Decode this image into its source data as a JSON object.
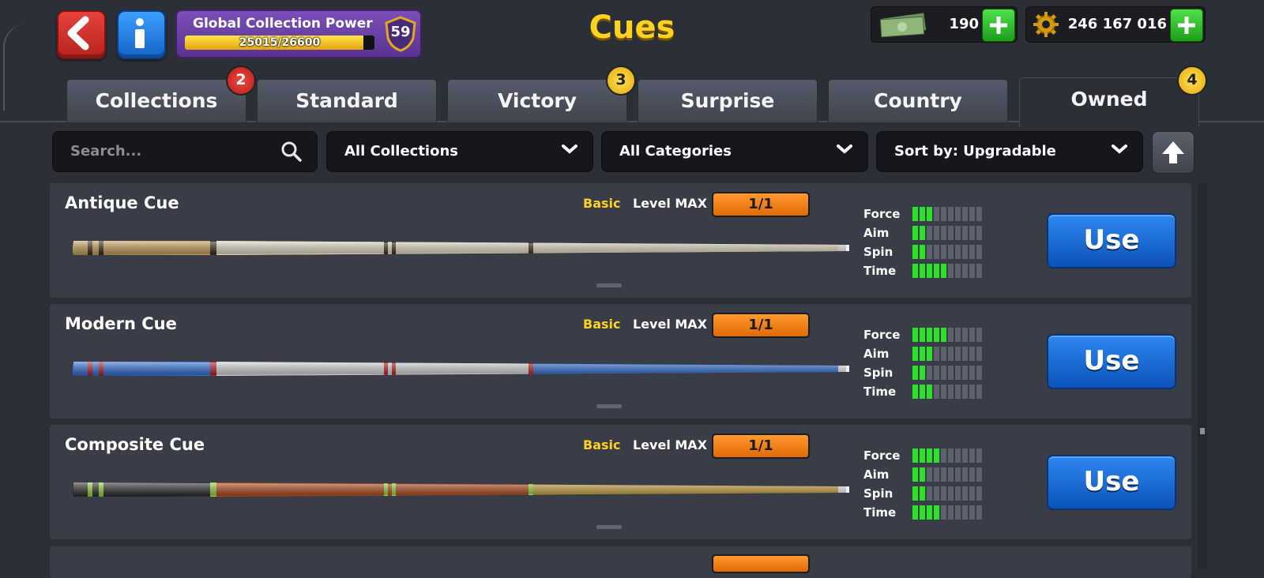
{
  "header": {
    "title": "Cues",
    "gcp": {
      "label": "Global Collection Power",
      "value_text": "25015/26600",
      "level": "59",
      "progress": 0.94
    },
    "cash": "190",
    "coins": "246 167 016"
  },
  "tabs": [
    {
      "label": "Collections",
      "badge": "2",
      "badge_color": "red"
    },
    {
      "label": "Standard",
      "badge": ""
    },
    {
      "label": "Victory",
      "badge": "3",
      "badge_color": "yellow"
    },
    {
      "label": "Surprise",
      "badge": ""
    },
    {
      "label": "Country",
      "badge": ""
    },
    {
      "label": "Owned",
      "badge": "4",
      "badge_color": "yellow",
      "active": true
    }
  ],
  "filters": {
    "search_placeholder": "Search...",
    "collections": "All Collections",
    "categories": "All Categories",
    "sort": "Sort by: Upgradable"
  },
  "stat_labels": {
    "force": "Force",
    "aim": "Aim",
    "spin": "Spin",
    "time": "Time"
  },
  "cues": [
    {
      "name": "Antique Cue",
      "rarity": "Basic",
      "level": "Level MAX",
      "progress": "1/1",
      "use": "Use",
      "stats": {
        "force": 3,
        "aim": 2,
        "spin": 2,
        "time": 5
      }
    },
    {
      "name": "Modern Cue",
      "rarity": "Basic",
      "level": "Level MAX",
      "progress": "1/1",
      "use": "Use",
      "stats": {
        "force": 5,
        "aim": 3,
        "spin": 2,
        "time": 3
      }
    },
    {
      "name": "Composite Cue",
      "rarity": "Basic",
      "level": "Level MAX",
      "progress": "1/1",
      "use": "Use",
      "stats": {
        "force": 4,
        "aim": 2,
        "spin": 2,
        "time": 4
      }
    }
  ],
  "colors": {
    "accent_yellow": "#ffd21f",
    "use_blue": "#1a6fd8",
    "stat_on": "#2de02a",
    "level_orange": "#f5820f"
  }
}
